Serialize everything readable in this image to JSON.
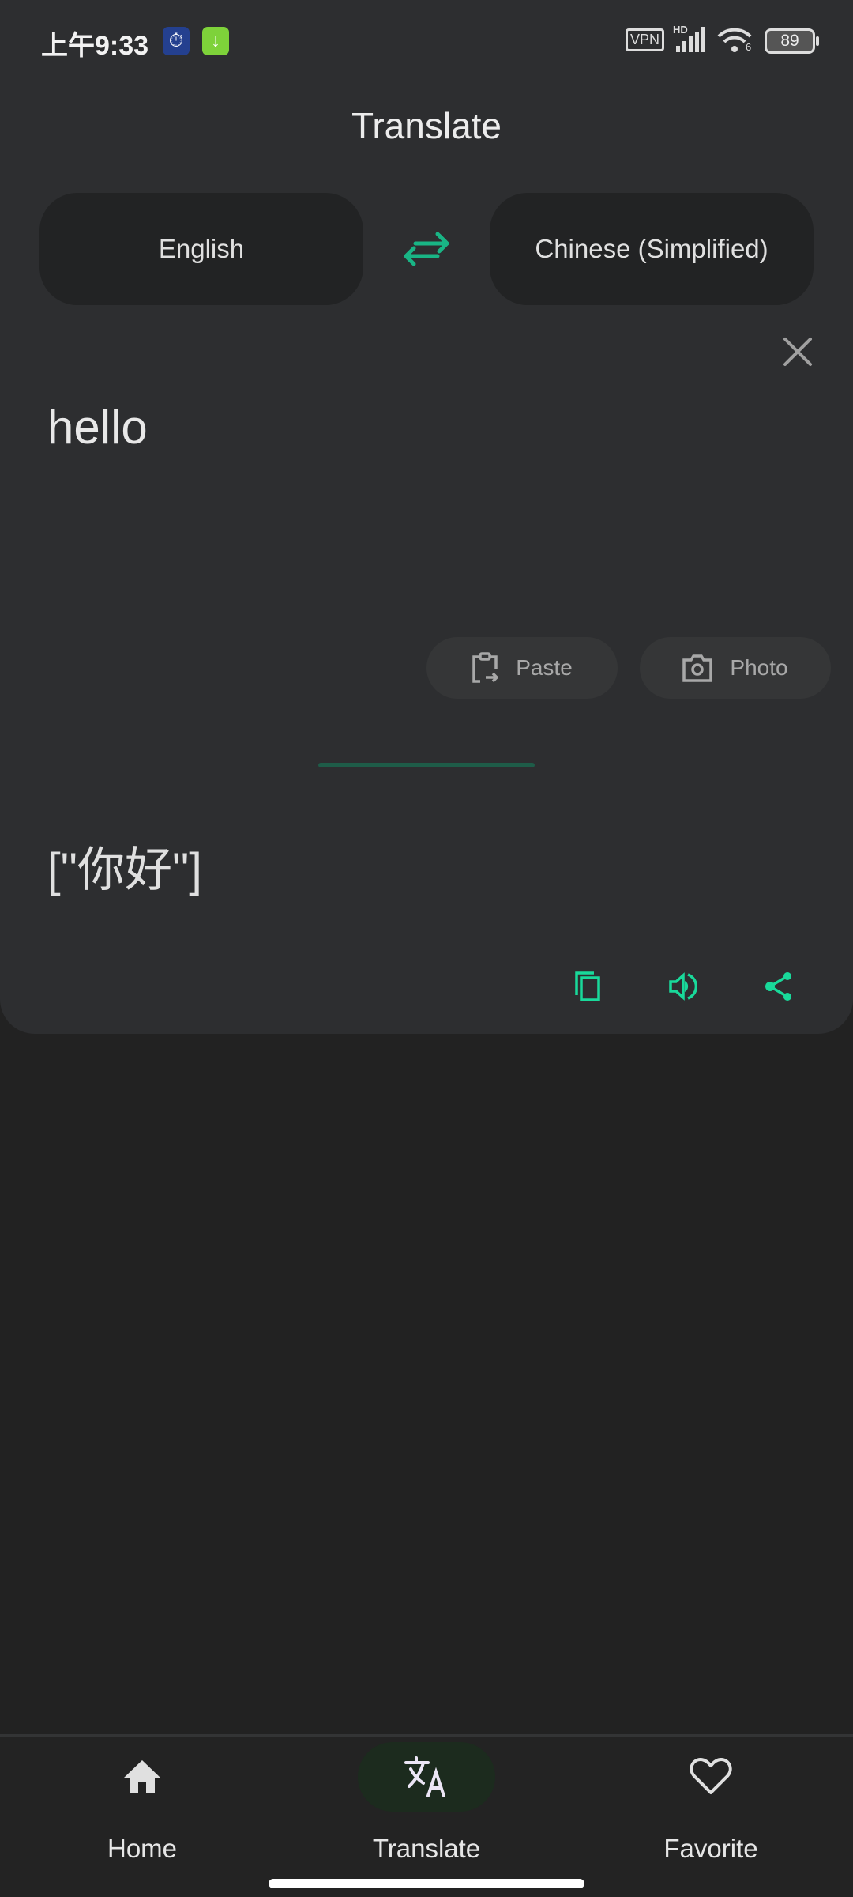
{
  "status_bar": {
    "time": "上午9:33",
    "vpn": "VPN",
    "signal_label": "HD",
    "wifi_label": "6",
    "battery": "89"
  },
  "header": {
    "title": "Translate"
  },
  "languages": {
    "source": "English",
    "target": "Chinese (Simplified)"
  },
  "input": {
    "text": "hello"
  },
  "buttons": {
    "paste": "Paste",
    "photo": "Photo"
  },
  "output": {
    "text": "[\"你好\"]"
  },
  "colors": {
    "accent": "#19d99a",
    "card": "#2d2e30",
    "background": "#222222",
    "nav_active": "#1c2b1e"
  },
  "nav": {
    "items": [
      {
        "label": "Home",
        "icon": "home-icon"
      },
      {
        "label": "Translate",
        "icon": "translate-icon",
        "active": true
      },
      {
        "label": "Favorite",
        "icon": "heart-icon"
      }
    ]
  }
}
